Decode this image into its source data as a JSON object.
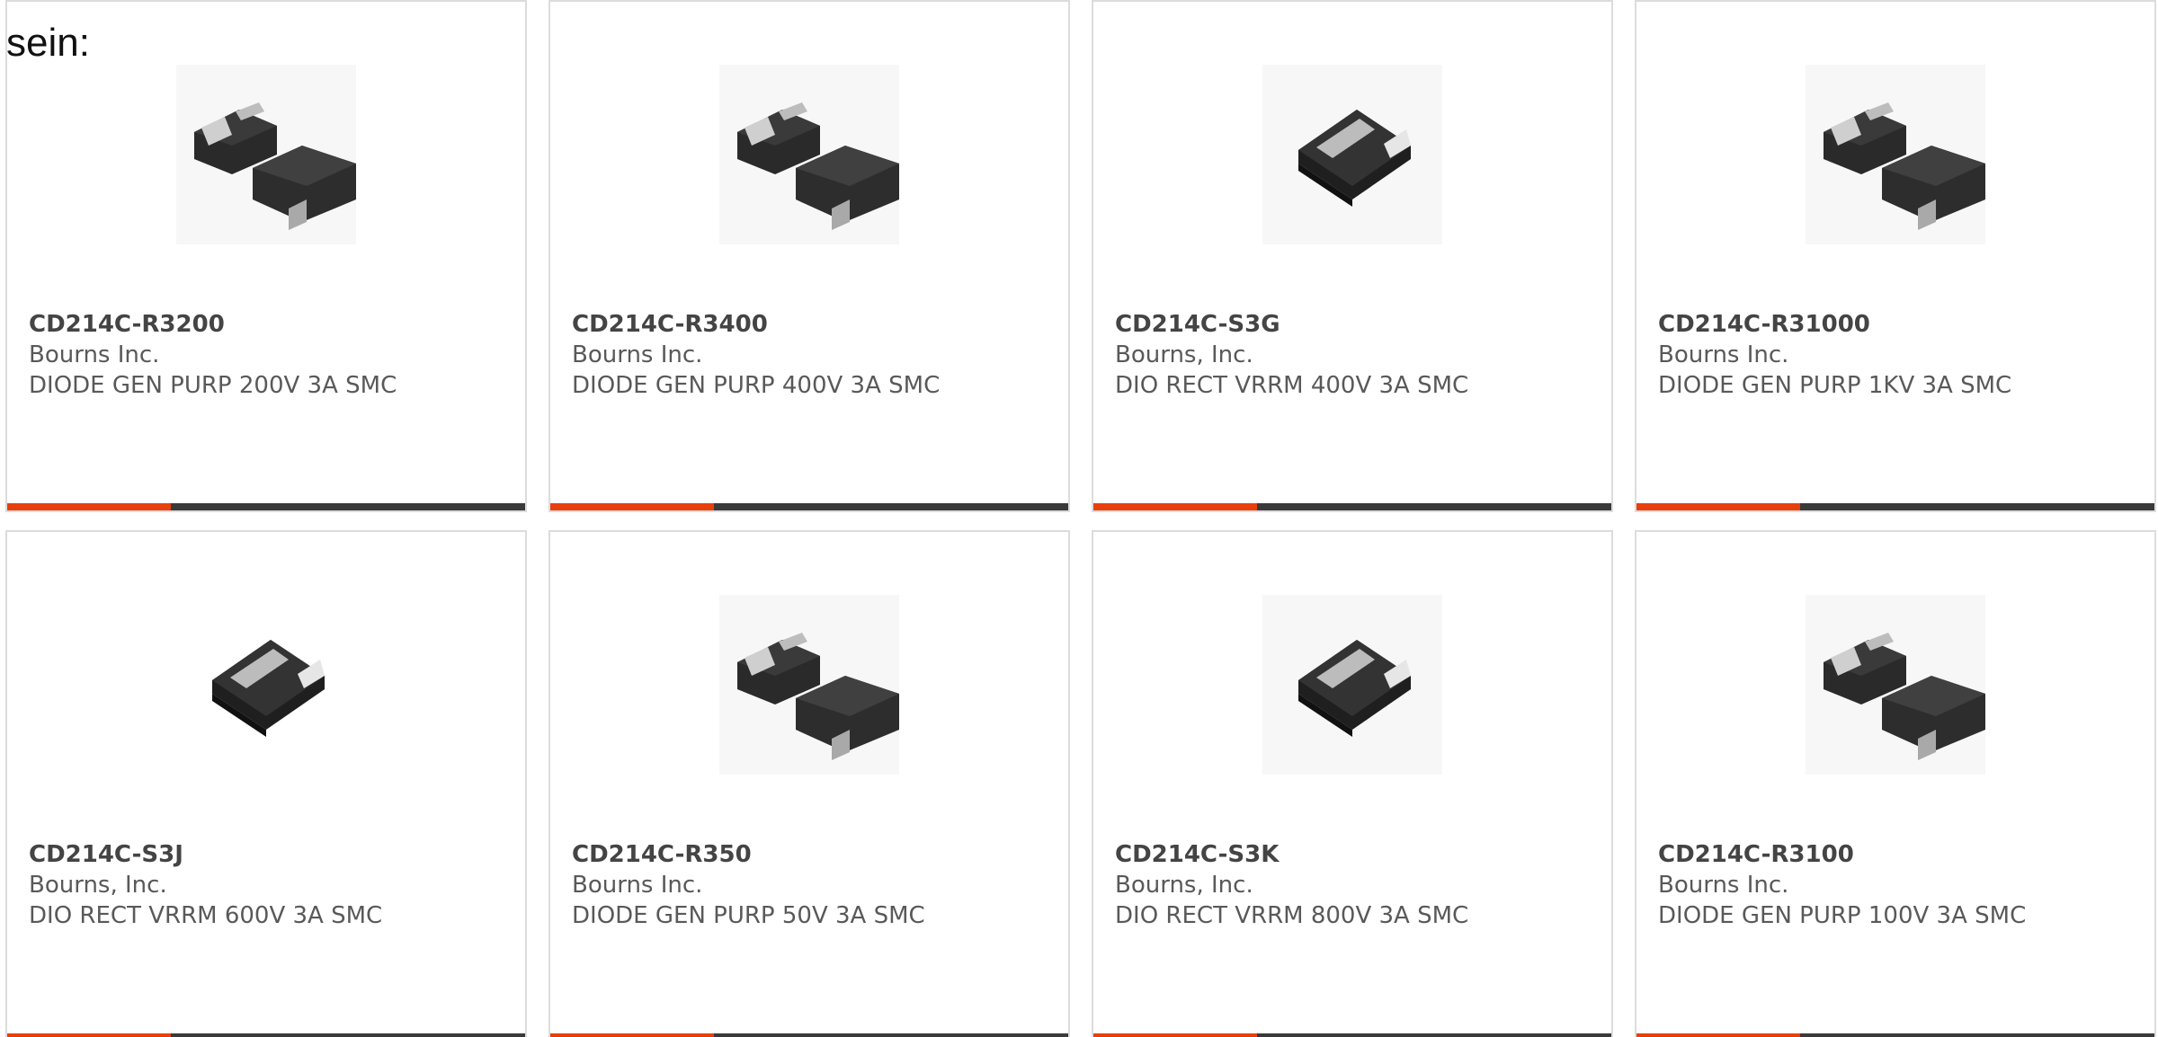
{
  "intro_text": "sein:",
  "colors": {
    "accent": "#e8400c",
    "bar": "#3a3a3a",
    "border": "#dcdcdc"
  },
  "products": [
    {
      "part_number": "CD214C-R3200",
      "manufacturer": "Bourns Inc.",
      "description": "DIODE GEN PURP 200V 3A SMC",
      "image_icon": "smc-package-pair-icon"
    },
    {
      "part_number": "CD214C-R3400",
      "manufacturer": "Bourns Inc.",
      "description": "DIODE GEN PURP 400V 3A SMC",
      "image_icon": "smc-package-pair-icon"
    },
    {
      "part_number": "CD214C-S3G",
      "manufacturer": "Bourns, Inc.",
      "description": "DIO RECT VRRM 400V 3A SMC",
      "image_icon": "smc-package-single-icon"
    },
    {
      "part_number": "CD214C-R31000",
      "manufacturer": "Bourns Inc.",
      "description": "DIODE GEN PURP 1KV 3A SMC",
      "image_icon": "smc-package-pair-icon"
    },
    {
      "part_number": "CD214C-S3J",
      "manufacturer": "Bourns, Inc.",
      "description": "DIO RECT VRRM 600V 3A SMC",
      "image_icon": "smc-package-single-icon"
    },
    {
      "part_number": "CD214C-R350",
      "manufacturer": "Bourns Inc.",
      "description": "DIODE GEN PURP 50V 3A SMC",
      "image_icon": "smc-package-pair-icon"
    },
    {
      "part_number": "CD214C-S3K",
      "manufacturer": "Bourns, Inc.",
      "description": "DIO RECT VRRM 800V 3A SMC",
      "image_icon": "smc-package-single-icon"
    },
    {
      "part_number": "CD214C-R3100",
      "manufacturer": "Bourns Inc.",
      "description": "DIODE GEN PURP 100V 3A SMC",
      "image_icon": "smc-package-pair-icon"
    }
  ]
}
